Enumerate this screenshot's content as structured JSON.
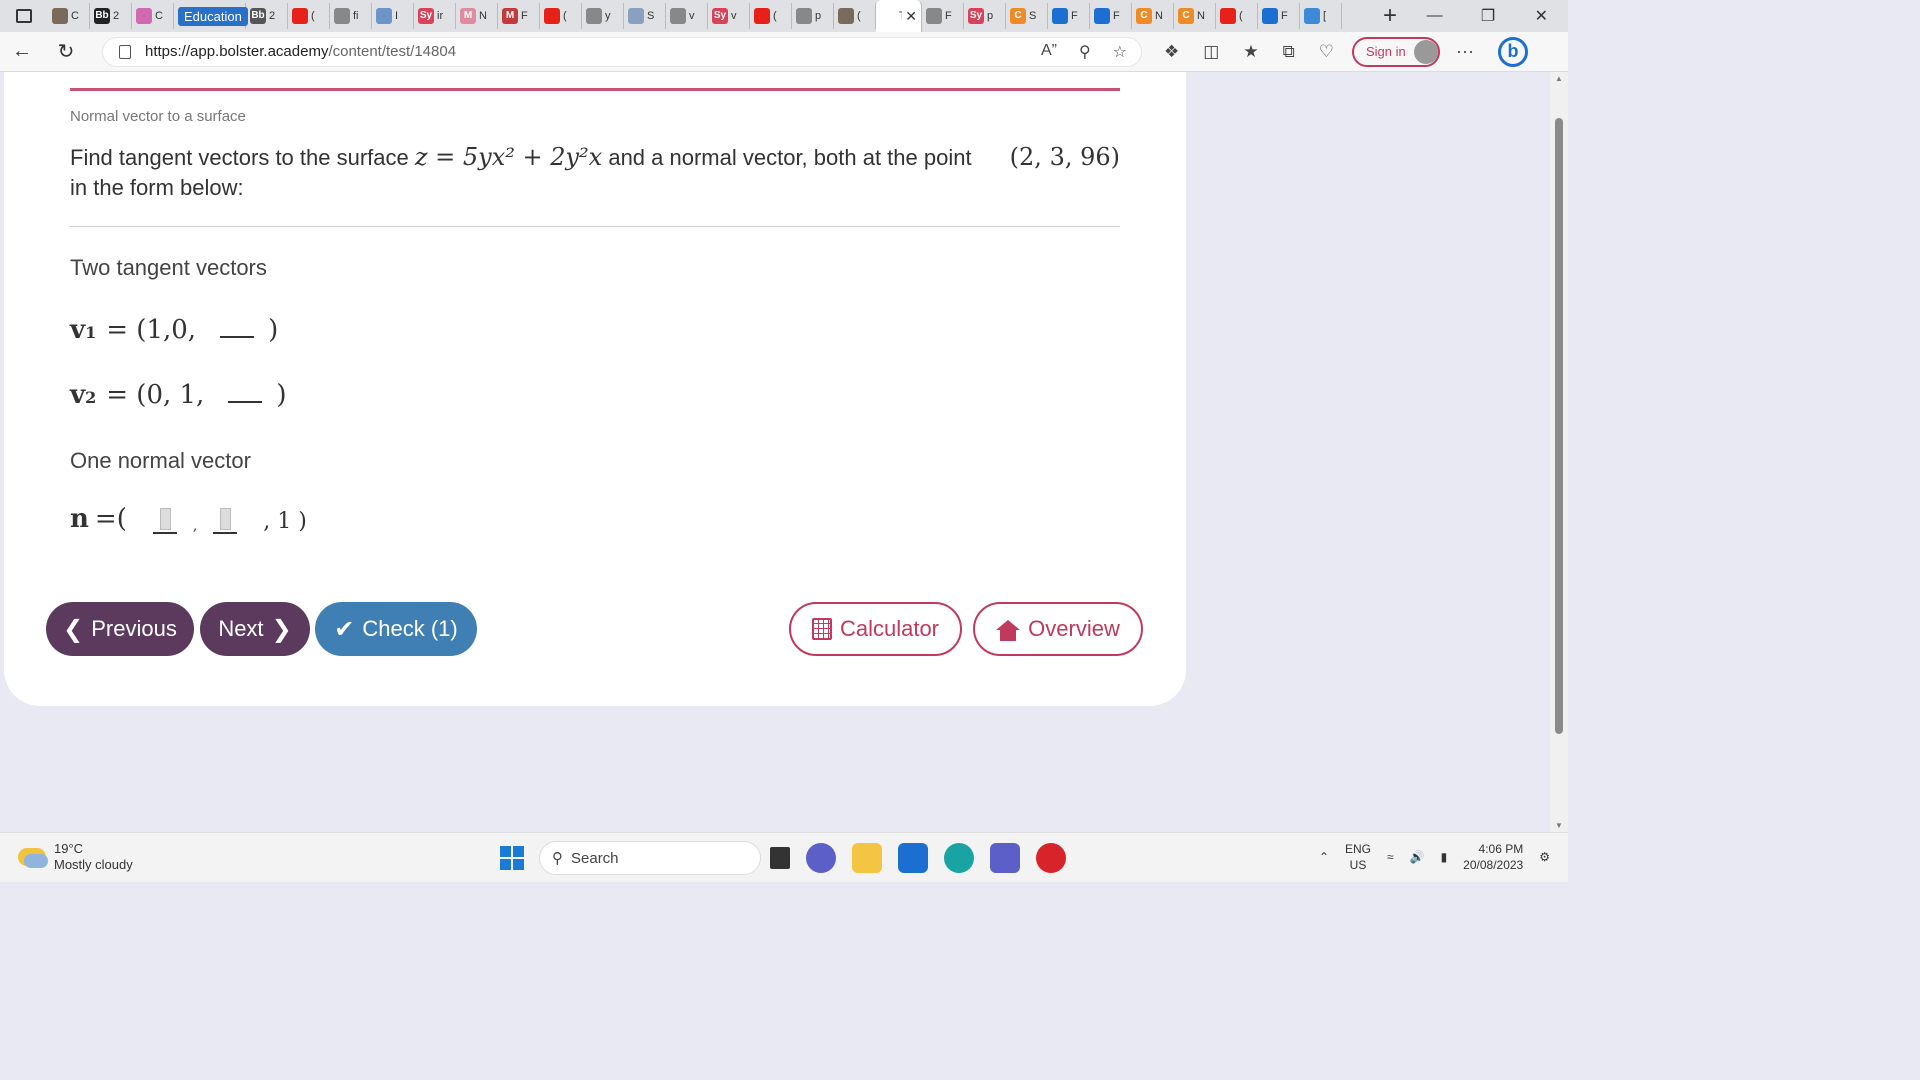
{
  "browser": {
    "tabs": [
      {
        "label": "C",
        "icon": "chart-icon",
        "color": "#7a6a5a"
      },
      {
        "label": "2",
        "icon": "blackboard-icon",
        "color": "#222222",
        "text": "Bb"
      },
      {
        "label": "C",
        "icon": "letter-b-icon",
        "color": "#d26ab3"
      },
      {
        "label": "Education",
        "icon": "education-icon",
        "color": "#2870c8"
      },
      {
        "label": "2",
        "icon": "blackboard-icon",
        "color": "#555555",
        "text": "Bb"
      },
      {
        "label": "(",
        "icon": "youtube-icon",
        "color": "#e62117"
      },
      {
        "label": "fi",
        "icon": "search-icon",
        "color": "#888888"
      },
      {
        "label": "I",
        "icon": "table-icon",
        "color": "#6c94c8"
      },
      {
        "label": "ir",
        "icon": "symbolab-icon",
        "color": "#d9435a",
        "text": "Sy"
      },
      {
        "label": "N",
        "icon": "m-icon",
        "color": "#e08ba0",
        "text": "M"
      },
      {
        "label": "F",
        "icon": "m-icon",
        "color": "#c23a3a",
        "text": "M"
      },
      {
        "label": "(",
        "icon": "youtube-icon",
        "color": "#e62117"
      },
      {
        "label": "y",
        "icon": "search-icon",
        "color": "#888888"
      },
      {
        "label": "S",
        "icon": "image-icon",
        "color": "#8aa0c0"
      },
      {
        "label": "v",
        "icon": "search-icon",
        "color": "#888888"
      },
      {
        "label": "v",
        "icon": "symbolab-icon",
        "color": "#d9435a",
        "text": "Sy"
      },
      {
        "label": "(",
        "icon": "youtube-icon",
        "color": "#e62117"
      },
      {
        "label": "p",
        "icon": "search-icon",
        "color": "#888888"
      },
      {
        "label": "(",
        "icon": "chart-icon",
        "color": "#7a6a5a"
      },
      {
        "label": "T",
        "icon": "active-tab",
        "color": "#ffffff",
        "active": true
      },
      {
        "label": "F",
        "icon": "search-icon",
        "color": "#888888"
      },
      {
        "label": "p",
        "icon": "symbolab-icon",
        "color": "#d9435a",
        "text": "Sy"
      },
      {
        "label": "S",
        "icon": "c-icon",
        "color": "#f08a24",
        "text": "C"
      },
      {
        "label": "F",
        "icon": "search-icon",
        "color": "#1c6fd1"
      },
      {
        "label": "F",
        "icon": "search-icon",
        "color": "#1c6fd1"
      },
      {
        "label": "N",
        "icon": "c-icon",
        "color": "#f08a24",
        "text": "C"
      },
      {
        "label": "N",
        "icon": "c-icon",
        "color": "#f08a24",
        "text": "C"
      },
      {
        "label": "(",
        "icon": "youtube-icon",
        "color": "#e62117"
      },
      {
        "label": "F",
        "icon": "search-icon",
        "color": "#1c6fd1"
      },
      {
        "label": "[",
        "icon": "copilot-icon",
        "color": "#3c8ad8"
      }
    ],
    "url_host": "https://app.bolster.academy",
    "url_path": "/content/test/14804",
    "signin_label": "Sign in"
  },
  "content": {
    "subtitle": "Normal vector to a surface",
    "question_prefix": "Find tangent vectors to the surface ",
    "equation": "z = 5yx² + 2y²x",
    "question_middle": " and a normal vector, both at the point ",
    "point": "(2, 3, 96)",
    "question_suffix": "in the form below:",
    "tangent_heading": "Two tangent vectors",
    "v1_name": "v",
    "v1_sub": "1",
    "v1_prefix": "= (1,0,",
    "v2_name": "v",
    "v2_sub": "2",
    "v2_prefix": "= (0, 1,",
    "close_paren": ")",
    "normal_heading": "One normal vector",
    "n_name": "n",
    "n_prefix": "=(",
    "n_comma": ",",
    "n_suffix": ", 1 )"
  },
  "buttons": {
    "previous": "Previous",
    "next": "Next",
    "check": "Check (1)",
    "calculator": "Calculator",
    "overview": "Overview"
  },
  "colors": {
    "accent": "#c0395e",
    "nav_button": "#5b3a5e",
    "check_button": "#3f7fb4"
  },
  "taskbar": {
    "temperature": "19°C",
    "weather": "Mostly cloudy",
    "search_placeholder": "Search",
    "lang": "ENG",
    "region": "US",
    "time": "4:06 PM",
    "date": "20/08/2023"
  }
}
